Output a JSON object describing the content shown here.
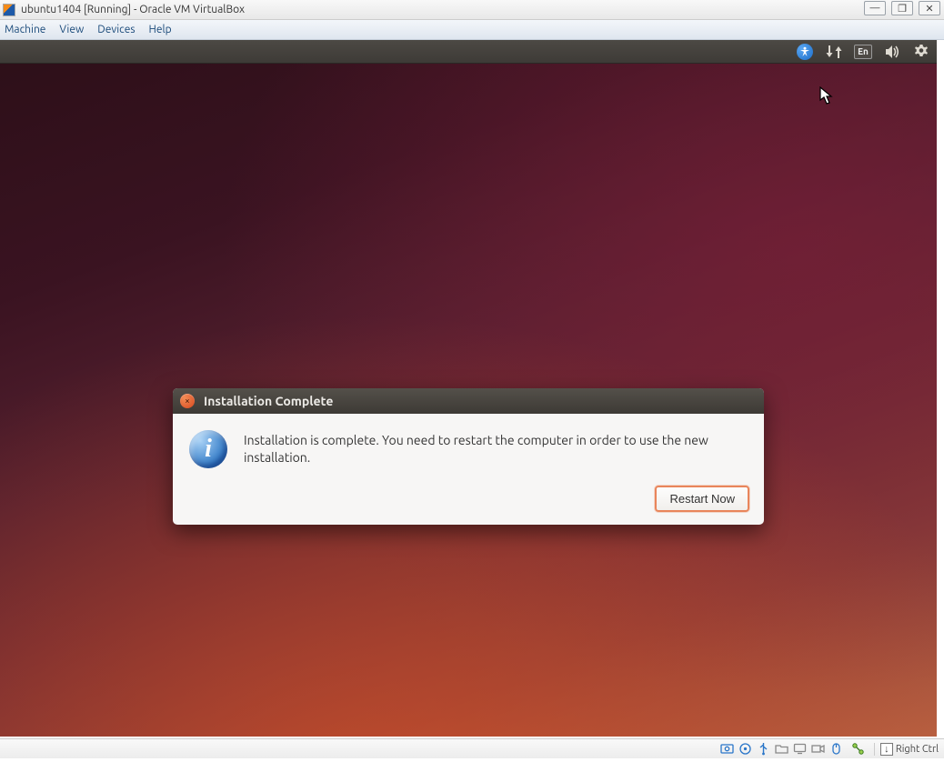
{
  "host": {
    "title": "ubuntu1404 [Running] - Oracle VM VirtualBox",
    "window_controls": {
      "min": "—",
      "max": "❐",
      "close": "✕"
    },
    "menu": {
      "machine": "Machine",
      "view": "View",
      "devices": "Devices",
      "help": "Help"
    },
    "status": {
      "hostkey_label": "Right Ctrl"
    }
  },
  "guest": {
    "panel": {
      "lang_badge": "En"
    },
    "dialog": {
      "title": "Installation Complete",
      "message": "Installation is complete. You need to restart the computer in order to use the new installation.",
      "button": "Restart Now",
      "info_glyph": "i",
      "close_glyph": "×"
    }
  }
}
